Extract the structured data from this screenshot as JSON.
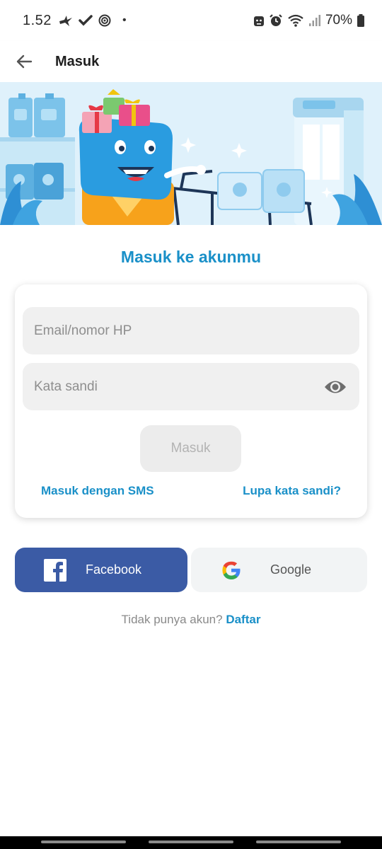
{
  "status_bar": {
    "time": "1.52",
    "battery": "70%",
    "dot": "•"
  },
  "app_bar": {
    "title": "Masuk"
  },
  "login": {
    "heading": "Masuk ke akunmu",
    "email_placeholder": "Email/nomor HP",
    "password_placeholder": "Kata sandi",
    "submit_label": "Masuk",
    "sms_link": "Masuk dengan SMS",
    "forgot_link": "Lupa kata sandi?"
  },
  "social": {
    "facebook_label": "Facebook",
    "google_label": "Google"
  },
  "register": {
    "prompt": "Tidak punya akun?",
    "link": "Daftar"
  },
  "colors": {
    "accent": "#1a90c8",
    "facebook": "#3b5ba5",
    "banner_bg": "#dff1fb"
  }
}
